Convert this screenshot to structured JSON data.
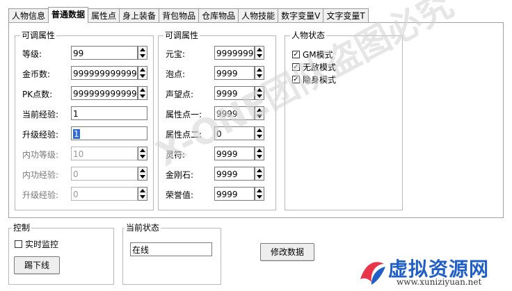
{
  "tabs": [
    "人物信息",
    "普通数据",
    "属性点",
    "身上装备",
    "背包物品",
    "仓库物品",
    "人物技能",
    "数字变量V",
    "文字变量T"
  ],
  "active_tab": "普通数据",
  "group_left": {
    "title": "可调属性",
    "rows": [
      {
        "label": "等级:",
        "value": "99",
        "spin": true,
        "disabled": false
      },
      {
        "label": "金币数:",
        "value": "9999999999999",
        "spin": true,
        "disabled": false
      },
      {
        "label": "PK点数:",
        "value": "9999999999999",
        "spin": true,
        "disabled": false
      },
      {
        "label": "当前经验:",
        "value": "1",
        "spin": false,
        "disabled": false
      },
      {
        "label": "升级经验:",
        "value": "1",
        "spin": false,
        "disabled": false,
        "selected": true
      },
      {
        "label": "内功等级:",
        "value": "10",
        "spin": true,
        "disabled": true
      },
      {
        "label": "内功经验:",
        "value": "0",
        "spin": true,
        "disabled": true
      },
      {
        "label": "升级经验:",
        "value": "0",
        "spin": true,
        "disabled": true
      }
    ]
  },
  "group_mid": {
    "title": "可调属性",
    "rows": [
      {
        "label": "元宝:",
        "value": "9999999"
      },
      {
        "label": "泡点:",
        "value": "9999"
      },
      {
        "label": "声望点:",
        "value": "9999"
      },
      {
        "label": "属性点一:",
        "value": "9999"
      },
      {
        "label": "属性点二:",
        "value": "0"
      },
      {
        "label": "灵符:",
        "value": "9999"
      },
      {
        "label": "金刚石:",
        "value": "9999"
      },
      {
        "label": "荣誉值:",
        "value": "9999"
      }
    ]
  },
  "group_status": {
    "title": "人物状态",
    "checks": [
      {
        "label": "GM模式",
        "checked": true
      },
      {
        "label": "无敌模式",
        "checked": true
      },
      {
        "label": "隐身模式",
        "checked": true
      }
    ]
  },
  "control": {
    "title": "控制",
    "monitor_label": "实时监控",
    "kick_button": "踢下线"
  },
  "status": {
    "title": "当前状态",
    "value": "在线"
  },
  "modify_button": "修改数据",
  "watermark": "X-ONE团队盗图必究",
  "logo": {
    "text": "虚拟资源网",
    "url": "www.xuniziyuan.net"
  },
  "colors": {
    "selection": "#2e6bd6",
    "logo_blue": "#1f5fc7",
    "logo_red": "#e8354a"
  }
}
